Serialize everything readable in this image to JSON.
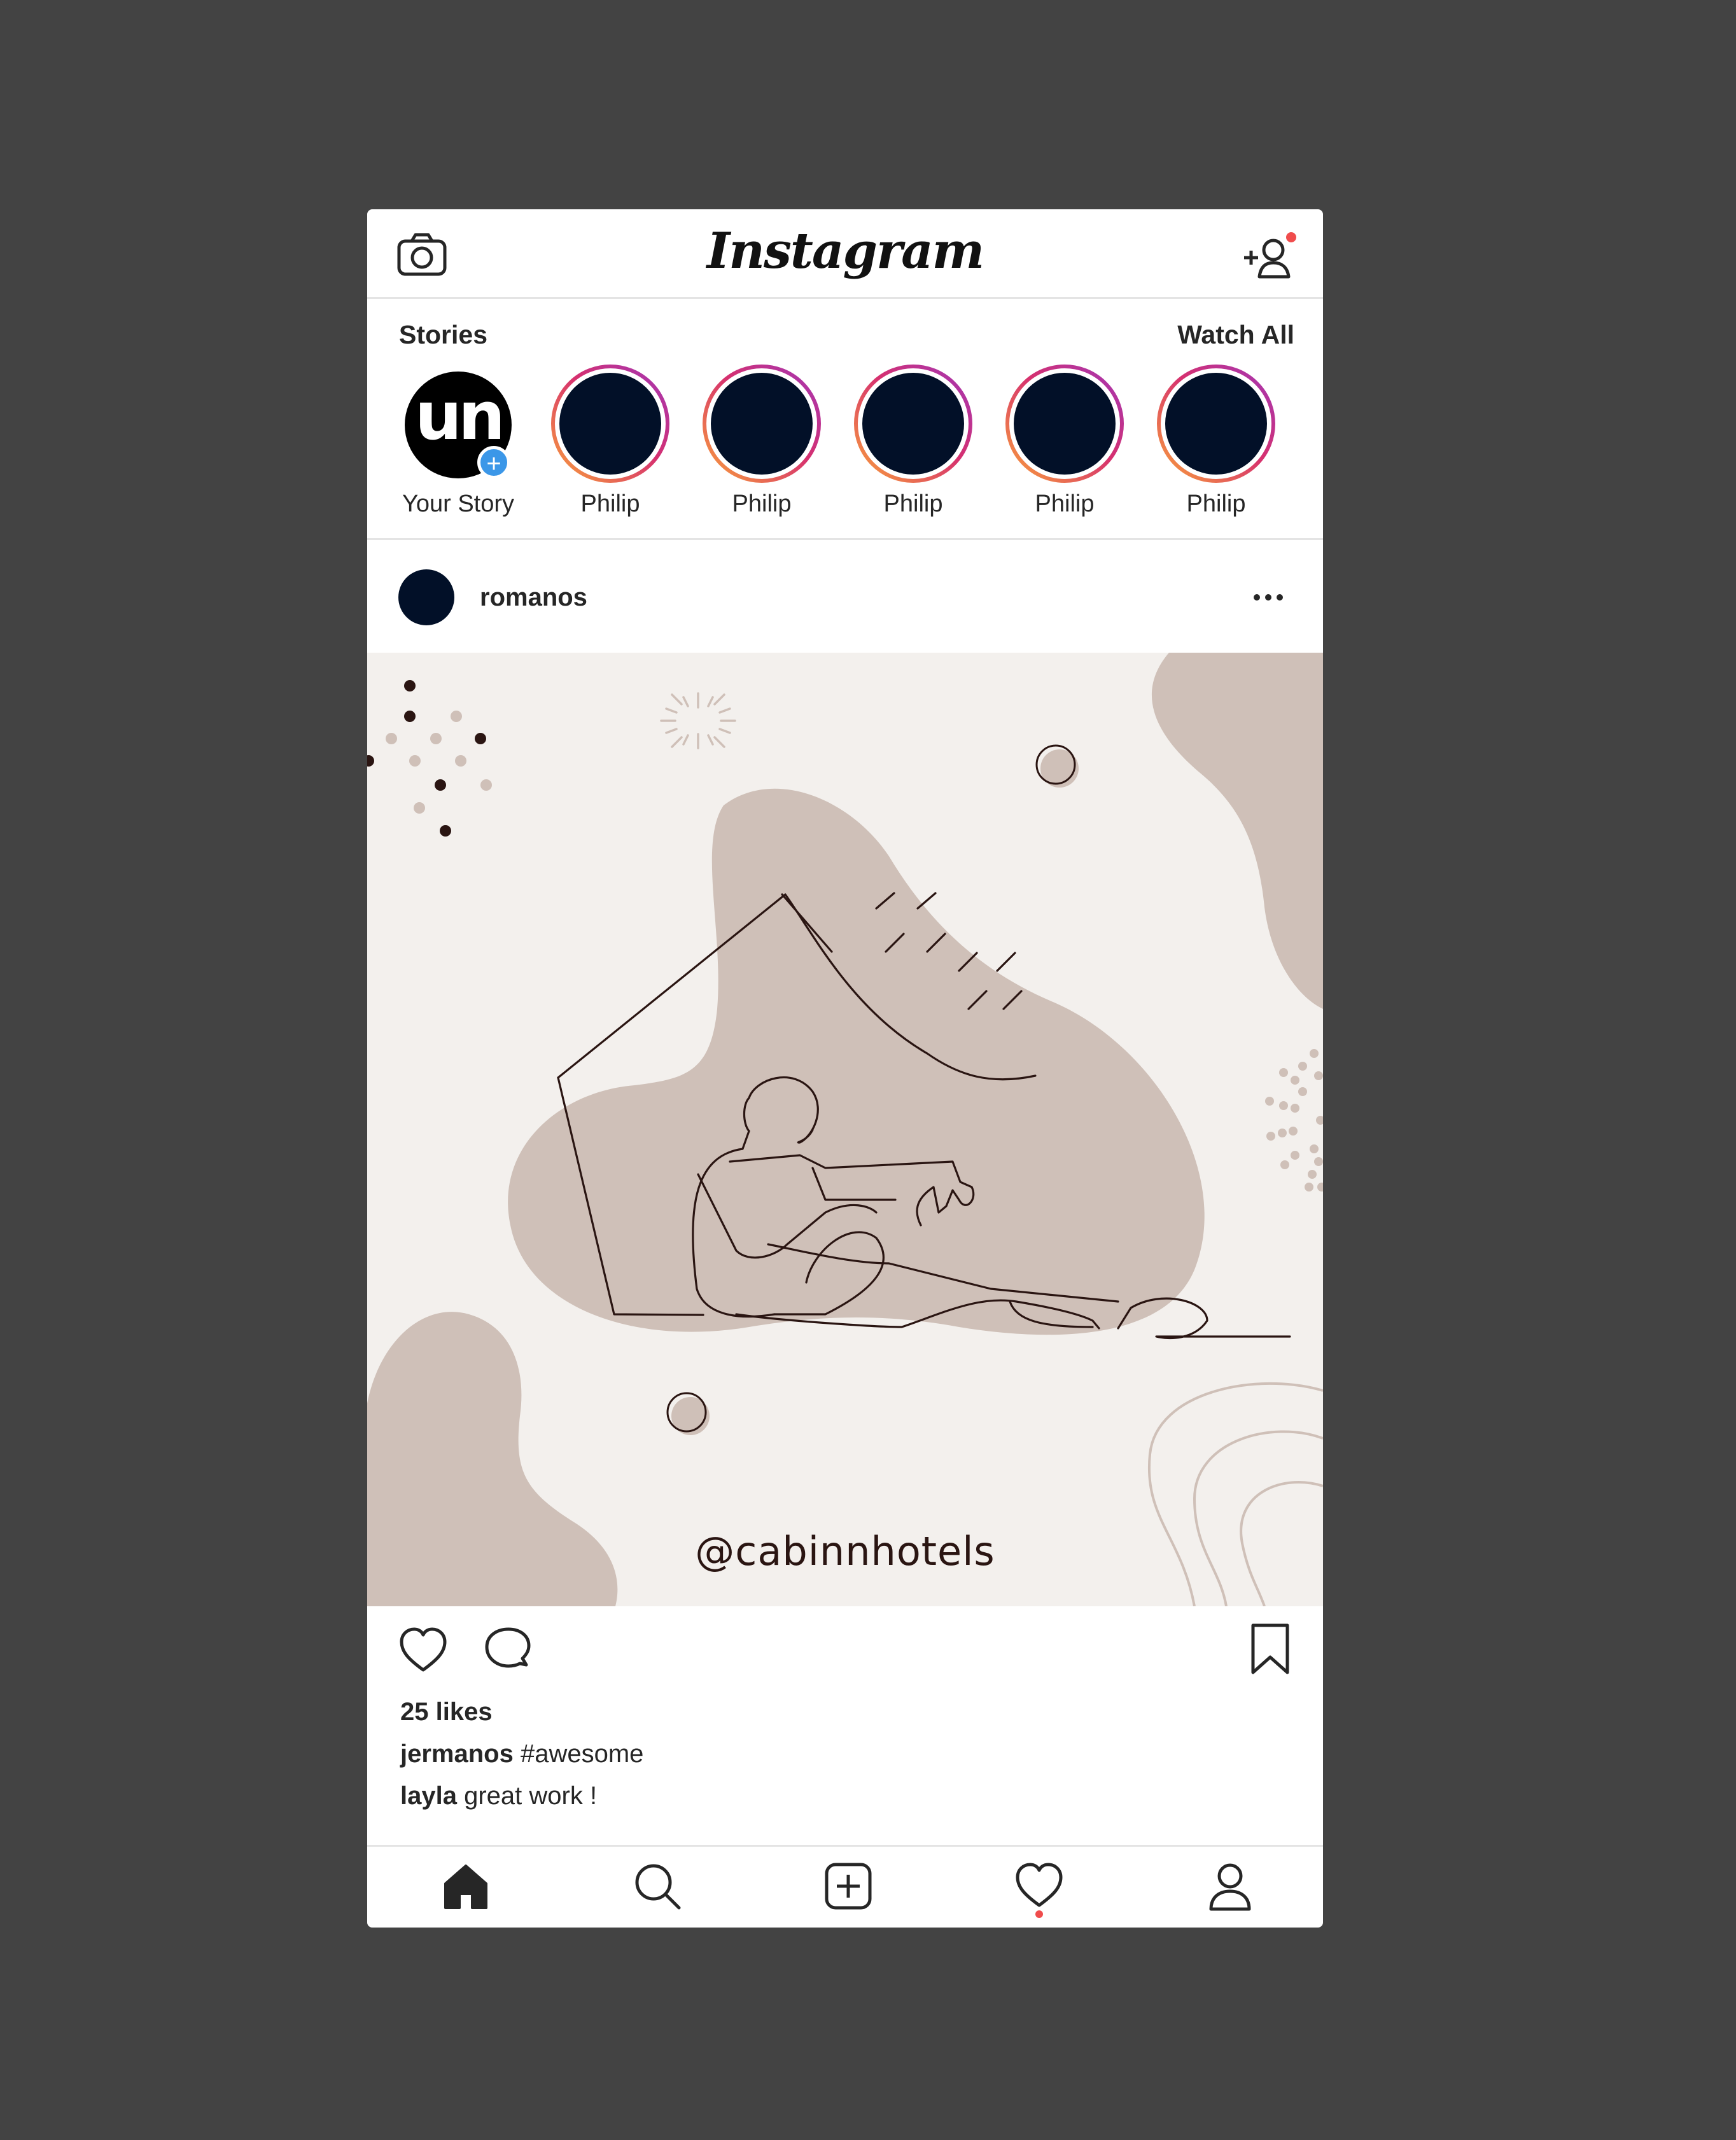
{
  "header": {
    "app_title": "Instagram",
    "left_icon": "camera-icon",
    "right_icon": "add-user-icon",
    "notification_color": "#f04c4c"
  },
  "stories": {
    "heading": "Stories",
    "watch_all": "Watch All",
    "own": {
      "label": "Your Story",
      "avatar_text": "un",
      "add_badge_color": "#3b97e8"
    },
    "items": [
      {
        "label": "Philip"
      },
      {
        "label": "Philip"
      },
      {
        "label": "Philip"
      },
      {
        "label": "Philip"
      },
      {
        "label": "Philip"
      }
    ],
    "ring_gradient": [
      "#f9a13b",
      "#d6306f",
      "#a136b8"
    ],
    "avatar_color": "#021028"
  },
  "post": {
    "username": "romanos",
    "more_icon": "more-horizontal-icon",
    "image": {
      "watermark": "@cabinnhotels",
      "background": "#f3f0ed",
      "blob_color": "#cfc0b8",
      "line_color": "#2a1512"
    },
    "likes": "25 likes",
    "comments": [
      {
        "user": "jermanos",
        "text": "#awesome"
      },
      {
        "user": "layla",
        "text": "great work !"
      }
    ]
  },
  "bottom_nav": {
    "items": [
      "home-icon",
      "search-icon",
      "add-post-icon",
      "activity-heart-icon",
      "profile-icon"
    ],
    "active_dot_color": "#f04c4c"
  }
}
